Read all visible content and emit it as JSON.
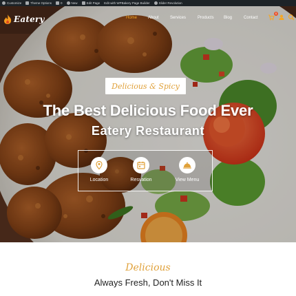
{
  "adminbar": {
    "items": [
      "Customize",
      "Theme Options",
      "0",
      "New",
      "Edit Page",
      "Edit with WPBakery Page Builder",
      "Slider Revolution"
    ]
  },
  "header": {
    "logo_text": "Eatery",
    "nav": [
      "Home",
      "About",
      "Services",
      "Products",
      "Blog",
      "Contact"
    ],
    "active_nav": "Home",
    "cart_count": "0"
  },
  "hero": {
    "tag": "Delicious & Spicy",
    "title": "The Best Delicious Food Ever",
    "subtitle": "Eatery Restaurant",
    "features": [
      {
        "label": "Location",
        "icon": "location-icon"
      },
      {
        "label": "Resvation",
        "icon": "calendar-icon"
      },
      {
        "label": "View Menu",
        "icon": "cloche-icon"
      }
    ]
  },
  "section": {
    "script": "Delicious",
    "title": "Always Fresh, Don't Miss It"
  },
  "colors": {
    "accent": "#f5a623",
    "script": "#e0a13a",
    "adminbar": "#1d2327",
    "badge": "#e8522a"
  }
}
